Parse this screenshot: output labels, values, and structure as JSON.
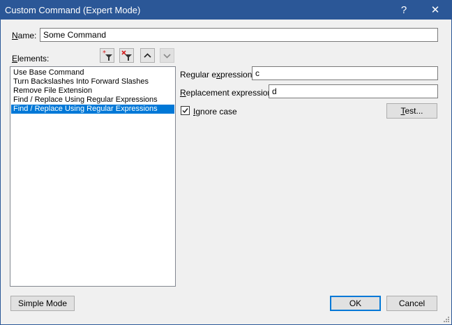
{
  "window": {
    "title": "Custom Command (Expert Mode)",
    "help_glyph": "?",
    "close_glyph": "✕"
  },
  "name_field": {
    "label_key": "N",
    "label_rest": "ame:",
    "value": "Some Command"
  },
  "elements": {
    "label_key": "E",
    "label_rest": "lements:",
    "toolbar": [
      {
        "name": "add-filter-icon",
        "enabled": true
      },
      {
        "name": "remove-filter-icon",
        "enabled": true
      },
      {
        "name": "move-up-icon",
        "enabled": true
      },
      {
        "name": "move-down-icon",
        "enabled": false
      }
    ],
    "items": [
      {
        "label": "Use Base Command",
        "selected": false
      },
      {
        "label": "Turn Backslashes Into Forward Slashes",
        "selected": false
      },
      {
        "label": "Remove File Extension",
        "selected": false
      },
      {
        "label": "Find / Replace Using Regular Expressions",
        "selected": false
      },
      {
        "label": "Find / Replace Using Regular Expressions",
        "selected": true
      }
    ]
  },
  "details": {
    "regex_label_pre": "Regular e",
    "regex_label_key": "x",
    "regex_label_post": "pression:",
    "regex_value": "c",
    "replacement_label_key": "R",
    "replacement_label_rest": "eplacement expression:",
    "replacement_value": "d",
    "ignore_case_key": "I",
    "ignore_case_rest": "gnore case",
    "ignore_case_checked": true,
    "test_button_key": "T",
    "test_button_rest": "est..."
  },
  "footer": {
    "simple_mode_label": "Simple Mode",
    "ok_label": "OK",
    "cancel_label": "Cancel"
  }
}
